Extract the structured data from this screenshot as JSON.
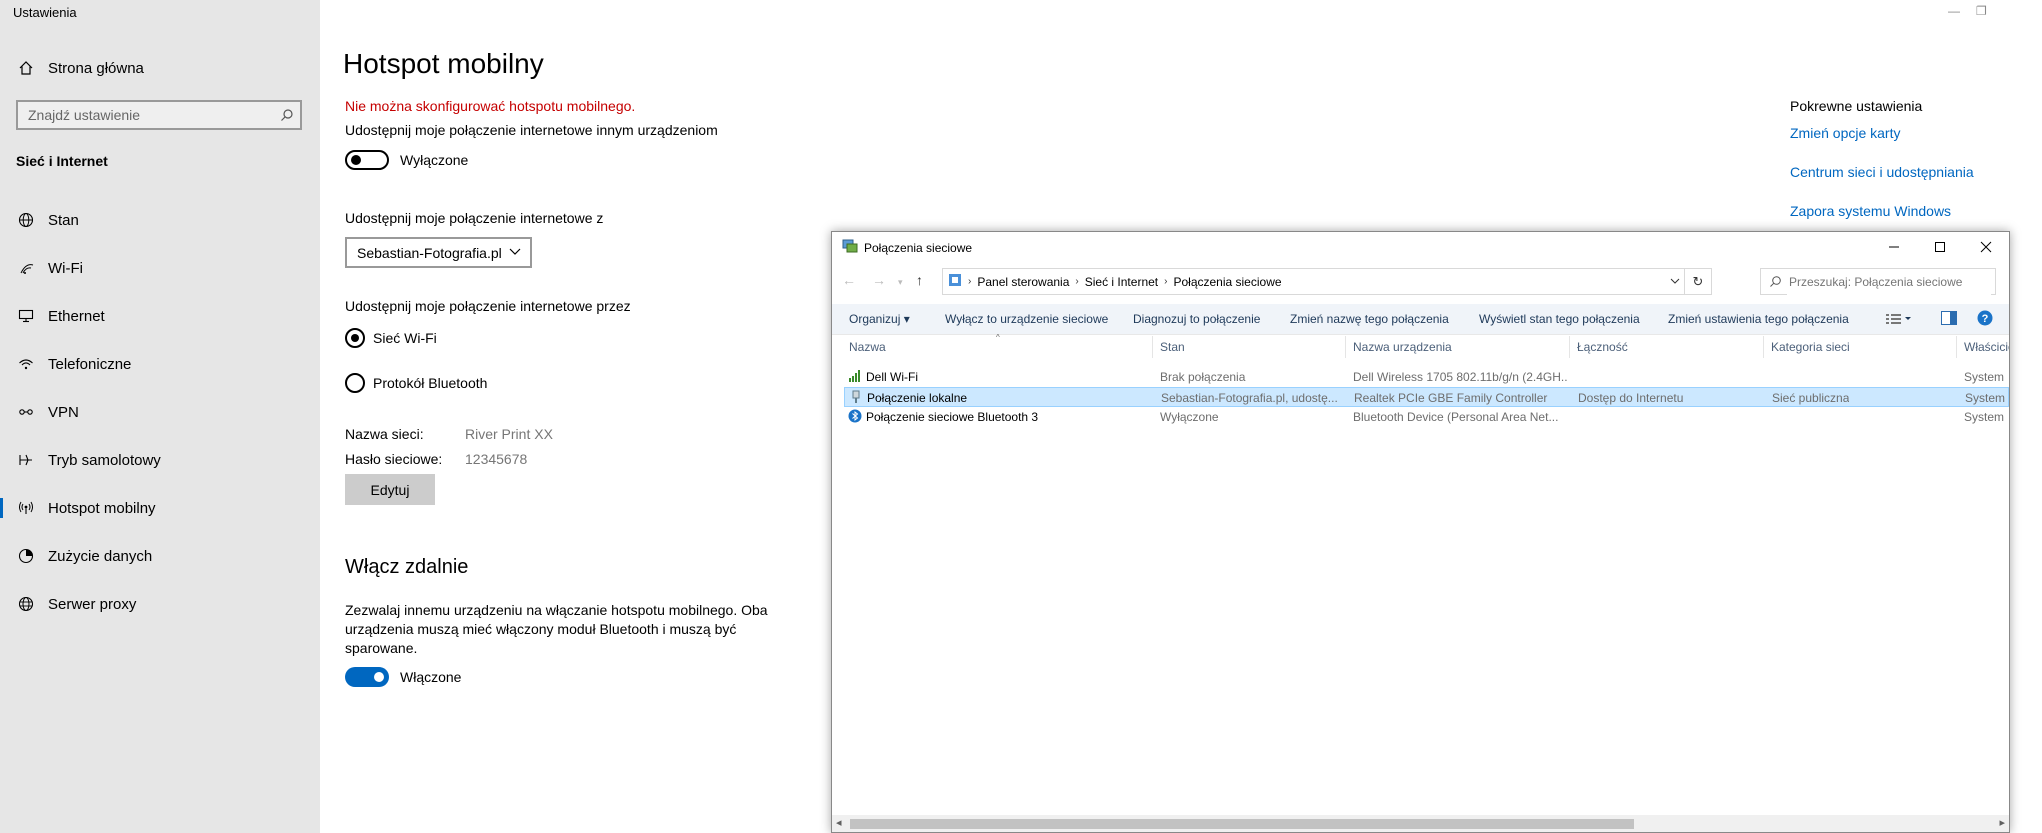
{
  "settings": {
    "app_title": "Ustawienia",
    "home_label": "Strona główna",
    "search_placeholder": "Znajdź ustawienie",
    "section_title": "Sieć i Internet",
    "nav": [
      {
        "label": "Stan",
        "icon": "globe-icon"
      },
      {
        "label": "Wi-Fi",
        "icon": "wifi-icon"
      },
      {
        "label": "Ethernet",
        "icon": "ethernet-icon"
      },
      {
        "label": "Telefoniczne",
        "icon": "dialup-icon"
      },
      {
        "label": "VPN",
        "icon": "vpn-icon"
      },
      {
        "label": "Tryb samolotowy",
        "icon": "airplane-icon"
      },
      {
        "label": "Hotspot mobilny",
        "icon": "hotspot-icon",
        "active": true
      },
      {
        "label": "Zużycie danych",
        "icon": "data-usage-icon"
      },
      {
        "label": "Serwer proxy",
        "icon": "proxy-icon"
      }
    ],
    "window_controls": {
      "minimize": "—",
      "restore": "❐"
    }
  },
  "main": {
    "title": "Hotspot mobilny",
    "error": "Nie można skonfigurować hotspotu mobilnego.",
    "share_label": "Udostępnij moje połączenie internetowe innym urządzeniom",
    "share_state": "Wyłączone",
    "share_from_label": "Udostępnij moje połączenie internetowe z",
    "share_from_value": "Sebastian-Fotografia.pl",
    "share_over_label": "Udostępnij moje połączenie internetowe przez",
    "share_over_options": [
      {
        "label": "Sieć Wi-Fi",
        "checked": true
      },
      {
        "label": "Protokół Bluetooth",
        "checked": false
      }
    ],
    "network_name_label": "Nazwa sieci:",
    "network_name_value": "River Print XX",
    "password_label": "Hasło sieciowe:",
    "password_value": "12345678",
    "edit_button": "Edytuj",
    "remote_title": "Włącz zdalnie",
    "remote_desc": "Zezwalaj innemu urządzeniu na włączanie hotspotu mobilnego. Oba urządzenia muszą mieć włączony moduł Bluetooth i muszą być sparowane.",
    "remote_state": "Włączone"
  },
  "related": {
    "title": "Pokrewne ustawienia",
    "links": [
      "Zmień opcje karty",
      "Centrum sieci i udostępniania",
      "Zapora systemu Windows"
    ]
  },
  "explorer": {
    "title": "Połączenia sieciowe",
    "breadcrumb": [
      "Panel sterowania",
      "Sieć i Internet",
      "Połączenia sieciowe"
    ],
    "search_placeholder": "Przeszukaj: Połączenia sieciowe",
    "toolbar": [
      "Organizuj ▾",
      "Wyłącz to urządzenie sieciowe",
      "Diagnozuj to połączenie",
      "Zmień nazwę tego połączenia",
      "Wyświetl stan tego połączenia",
      "Zmień ustawienia tego połączenia"
    ],
    "columns": [
      "Nazwa",
      "Stan",
      "Nazwa urządzenia",
      "Łączność",
      "Kategoria sieci",
      "Właściciel"
    ],
    "rows": [
      {
        "name": "Dell Wi-Fi",
        "icon": "wifi-signal-icon",
        "status": "Brak połączenia",
        "device": "Dell Wireless 1705 802.11b/g/n (2.4GH...",
        "connectivity": "",
        "category": "",
        "owner": "System",
        "selected": false
      },
      {
        "name": "Połączenie lokalne",
        "icon": "ethernet-adapter-icon",
        "status": "Sebastian-Fotografia.pl, udostę...",
        "device": "Realtek PCIe GBE Family Controller",
        "connectivity": "Dostęp do Internetu",
        "category": "Sieć publiczna",
        "owner": "System",
        "selected": true
      },
      {
        "name": "Połączenie sieciowe Bluetooth 3",
        "icon": "bluetooth-icon",
        "status": "Wyłączone",
        "device": "Bluetooth Device (Personal Area Net...",
        "connectivity": "",
        "category": "",
        "owner": "System",
        "selected": false
      }
    ]
  }
}
